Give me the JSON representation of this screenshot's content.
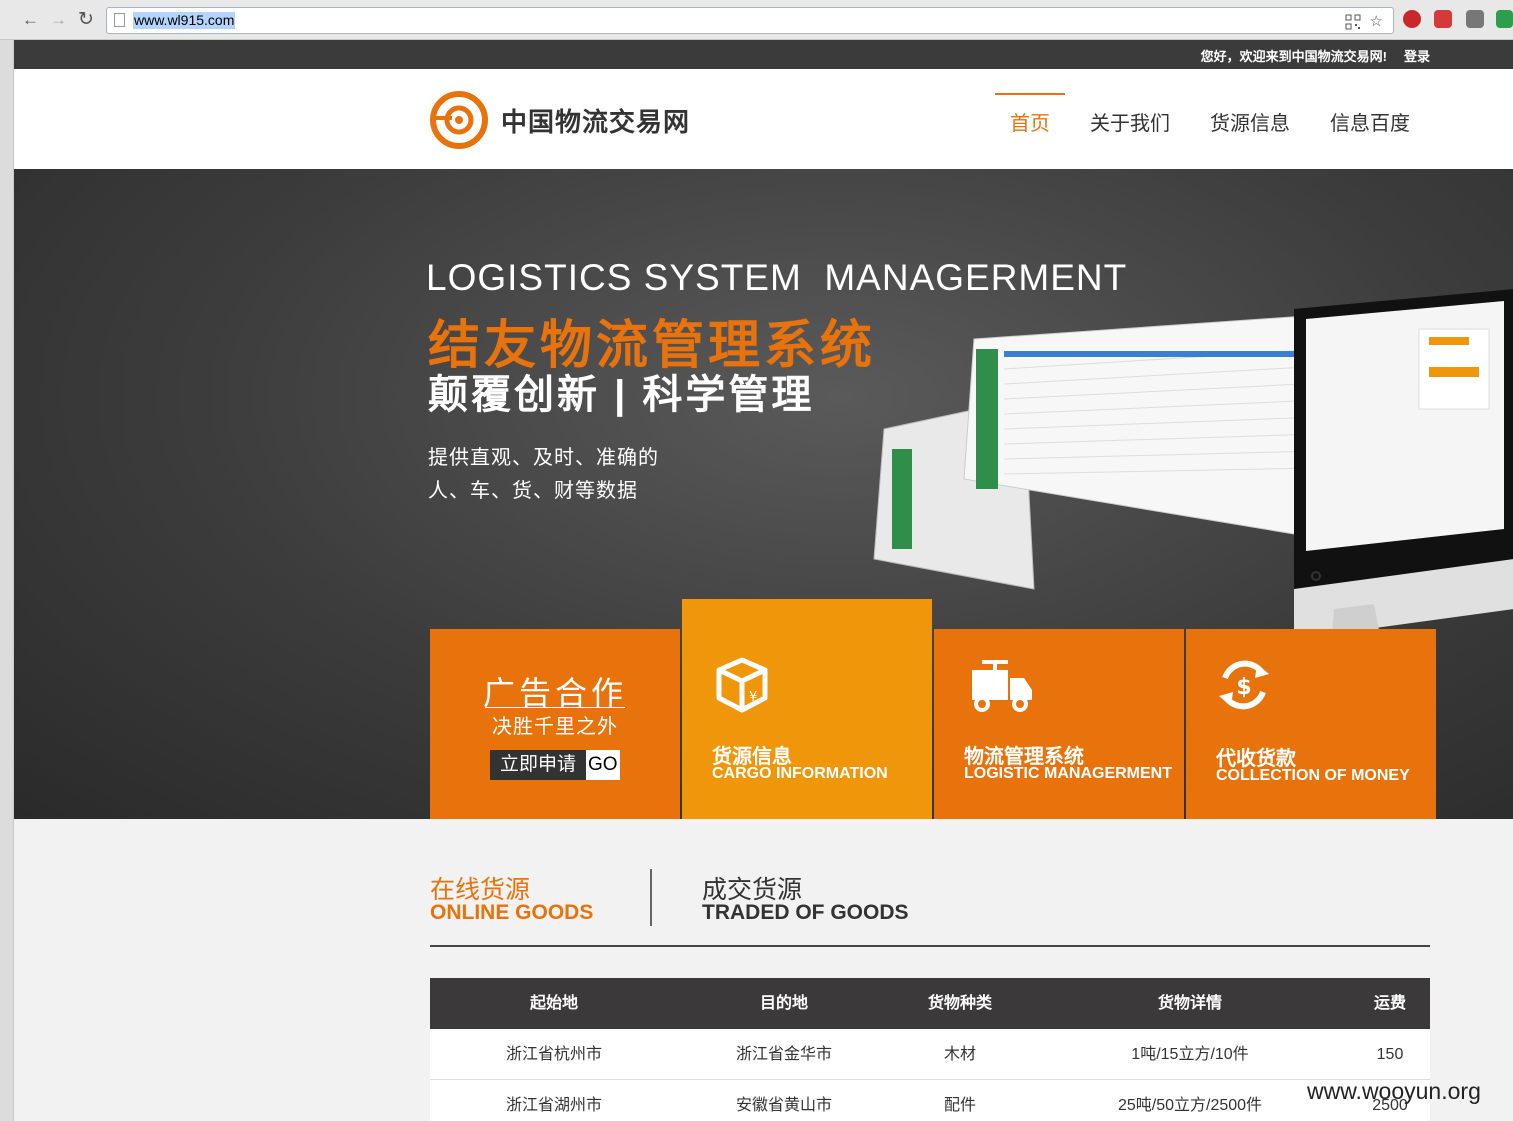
{
  "browser": {
    "back_glyph": "←",
    "forward_glyph": "→",
    "reload_glyph": "↻",
    "url": "www.wl915.com"
  },
  "topbar": {
    "welcome": "您好，欢迎来到中国物流交易网!",
    "login": "登录"
  },
  "header": {
    "logo_text": "中国物流交易网",
    "nav": [
      {
        "label": "首页",
        "active": true
      },
      {
        "label": "关于我们",
        "active": false
      },
      {
        "label": "货源信息",
        "active": false
      },
      {
        "label": "信息百度",
        "active": false
      }
    ]
  },
  "hero": {
    "title_en": "LOGISTICS SYSTEM  MANAGERMENT",
    "title_cn": "结友物流管理系统",
    "slogan": "颠覆创新 | 科学管理",
    "desc_line1": "提供直观、及时、准确的",
    "desc_line2": "人、车、货、财等数据"
  },
  "ad_tile": {
    "title": "广告合作",
    "subtitle": "决胜千里之外",
    "apply_label": "立即申请",
    "go_label": "GO"
  },
  "feature_tiles": [
    {
      "icon": "cargo-box-icon",
      "cn": "货源信息",
      "en": "CARGO INFORMATION"
    },
    {
      "icon": "truck-icon",
      "cn": "物流管理系统",
      "en": "LOGISTIC MANAGERMENT"
    },
    {
      "icon": "money-cycle-icon",
      "cn": "代收货款",
      "en": "COLLECTION OF MONEY"
    }
  ],
  "goods_tabs": [
    {
      "cn": "在线货源",
      "en": "ONLINE GOODS",
      "active": true
    },
    {
      "cn": "成交货源",
      "en": "TRADED OF GOODS",
      "active": false
    }
  ],
  "table": {
    "headers": [
      "起始地",
      "目的地",
      "货物种类",
      "货物详情",
      "运费"
    ],
    "rows": [
      [
        "浙江省杭州市",
        "浙江省金华市",
        "木材",
        "1吨/15立方/10件",
        "150"
      ],
      [
        "浙江省湖州市",
        "安徽省黄山市",
        "配件",
        "25吨/50立方/2500件",
        "2500"
      ]
    ]
  },
  "watermark": "www.wooyun.org",
  "colors": {
    "accent": "#e8730d",
    "accent_light": "#f0960a",
    "dark": "#3b3b3b"
  }
}
